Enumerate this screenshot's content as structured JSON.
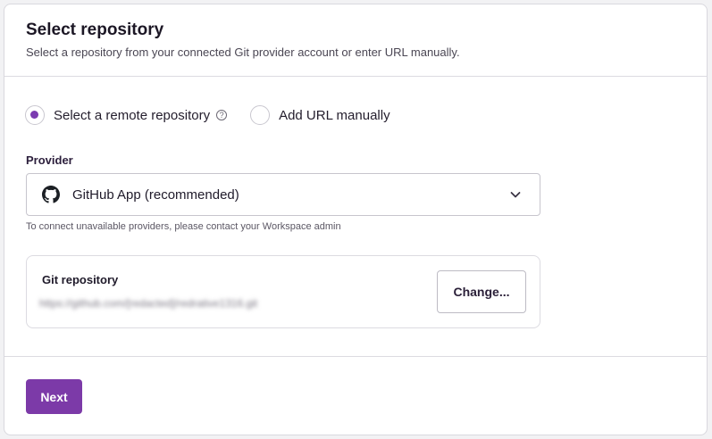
{
  "header": {
    "title": "Select repository",
    "subtitle": "Select a repository from your connected Git provider account or enter URL manually."
  },
  "source_options": [
    {
      "label": "Select a remote repository",
      "selected": true,
      "has_help_icon": true
    },
    {
      "label": "Add URL manually",
      "selected": false
    }
  ],
  "provider": {
    "label": "Provider",
    "selected_value": "GitHub App (recommended)",
    "icon": "github-icon",
    "hint": "To connect unavailable providers, please contact your Workspace admin"
  },
  "git_repository": {
    "label": "Git repository",
    "url": "https://github.com/[redacted]/redrative1316.git",
    "change_label": "Change..."
  },
  "footer": {
    "next_label": "Next"
  },
  "colors": {
    "accent": "#7c3aa8",
    "radio_selected": "#7b3bb0"
  }
}
